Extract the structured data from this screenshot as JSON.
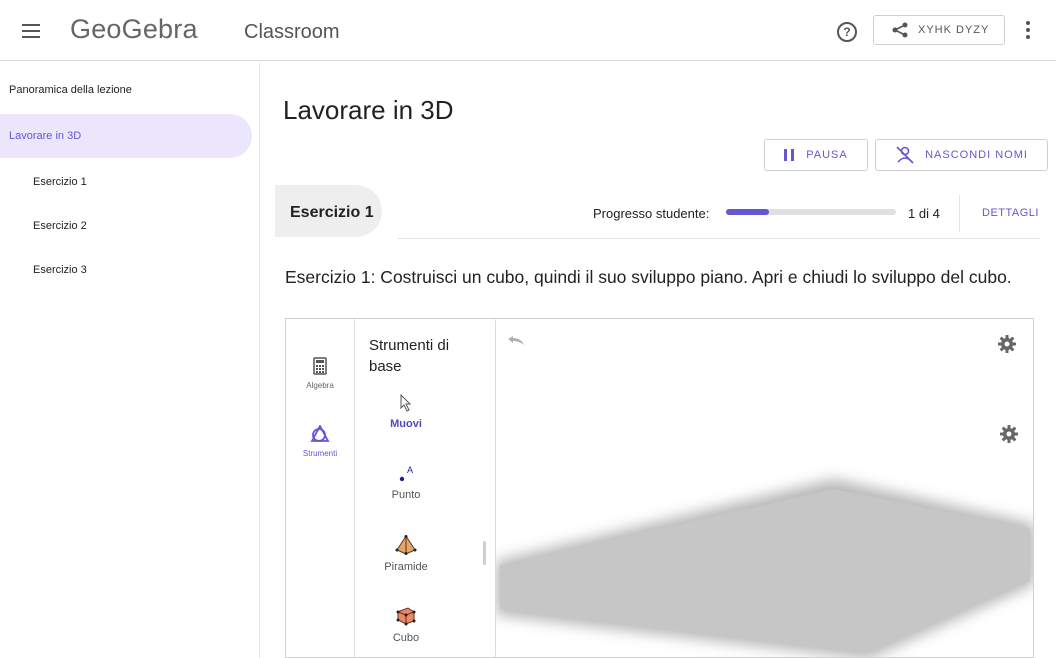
{
  "header": {
    "logo": "GeoGebra",
    "app_name": "Classroom",
    "share_code": "XYHK DYZY",
    "icons": [
      "menu-icon",
      "help-icon",
      "share-icon",
      "more-vert-icon"
    ]
  },
  "sidebar": {
    "overview": "Panoramica della lezione",
    "active": "Lavorare in 3D",
    "items": [
      "Esercizio 1",
      "Esercizio 2",
      "Esercizio 3"
    ]
  },
  "main": {
    "title": "Lavorare in 3D",
    "pause_label": "PAUSA",
    "hide_names_label": "NASCONDI NOMI",
    "exercise_tab": "Esercizio 1",
    "progress_label": "Progresso studente:",
    "progress_fraction": 0.25,
    "progress_count": "1 di 4",
    "details_label": "DETTAGLI",
    "exercise_text": "Esercizio 1: Costruisci un cubo, quindi il suo sviluppo piano. Apri e chiudi lo sviluppo del cubo."
  },
  "applet": {
    "rail": {
      "algebra": "Algebra",
      "tools": "Strumenti"
    },
    "panel_title": "Strumenti di base",
    "tools": {
      "move": "Muovi",
      "point": "Punto",
      "pyramid": "Piramide",
      "cube": "Cubo"
    },
    "accent_color": "#6557d2"
  }
}
